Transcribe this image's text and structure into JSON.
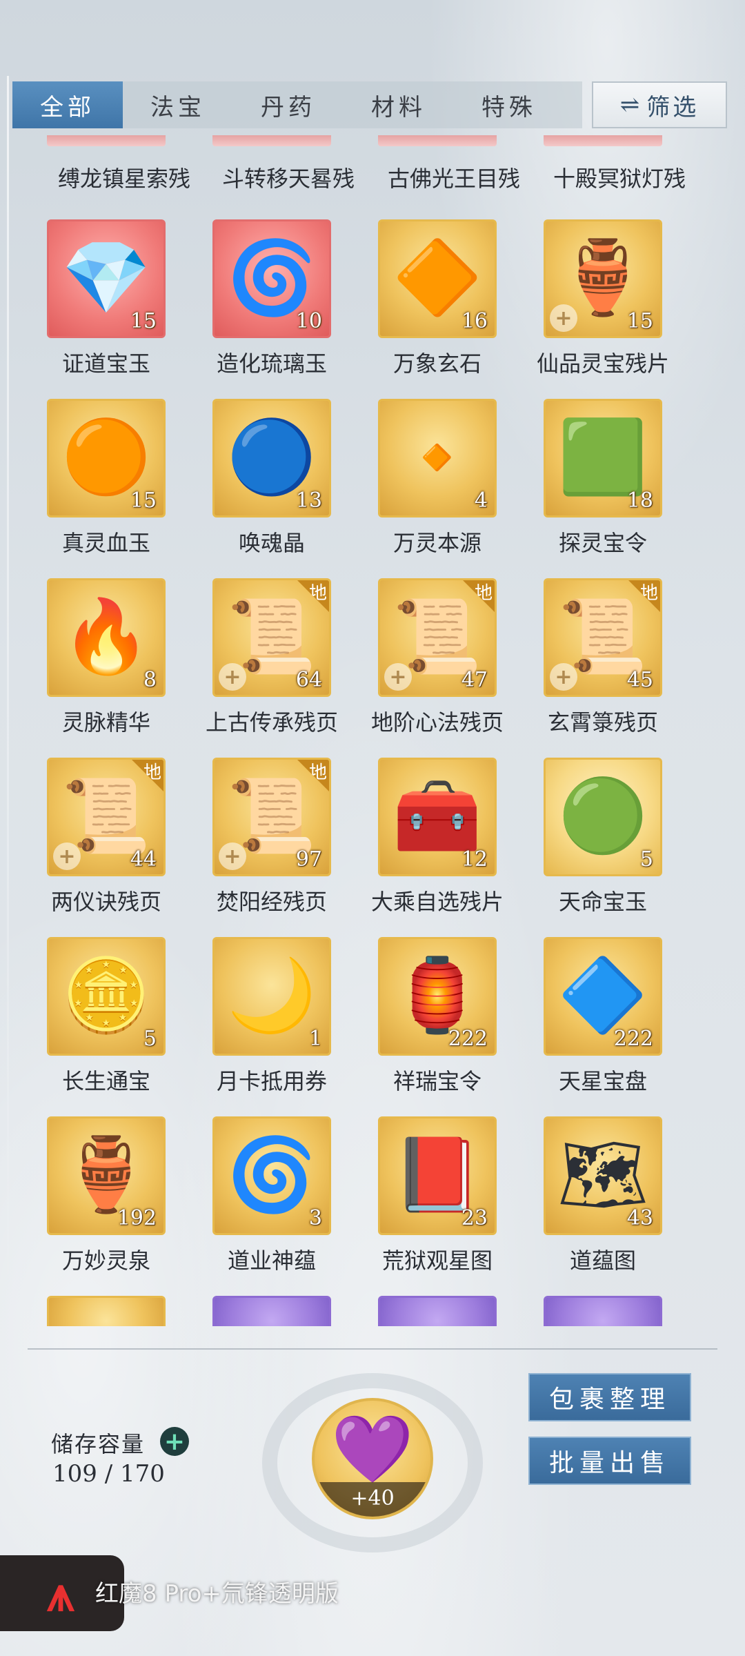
{
  "tabs": [
    {
      "label": "全部",
      "active": true
    },
    {
      "label": "法宝",
      "active": false
    },
    {
      "label": "丹药",
      "active": false
    },
    {
      "label": "材料",
      "active": false
    },
    {
      "label": "特殊",
      "active": false
    }
  ],
  "filter": {
    "label": "筛选",
    "icon": "swap-arrows-icon"
  },
  "partial_top_row": [
    {
      "name": "缚龙镇星索残"
    },
    {
      "name": "斗转移天晷残"
    },
    {
      "name": "古佛光王目残"
    },
    {
      "name": "十殿冥狱灯残"
    }
  ],
  "items": [
    {
      "name": "证道宝玉",
      "count": "15",
      "tier": "red",
      "icon": "crystal-icon",
      "glyph": "💎"
    },
    {
      "name": "造化琉璃玉",
      "count": "10",
      "tier": "red",
      "icon": "green-jade-icon",
      "glyph": "🌀"
    },
    {
      "name": "万象玄石",
      "count": "16",
      "tier": "gold",
      "icon": "mystic-stone-icon",
      "glyph": "🔶"
    },
    {
      "name": "仙品灵宝残片",
      "count": "15",
      "tier": "gold",
      "icon": "treasure-fragment-icon",
      "glyph": "🏺",
      "plus": true
    },
    {
      "name": "真灵血玉",
      "count": "15",
      "tier": "gold",
      "icon": "blood-jade-icon",
      "glyph": "🟠"
    },
    {
      "name": "唤魂晶",
      "count": "13",
      "tier": "gold",
      "icon": "soul-crystal-icon",
      "glyph": "🔵"
    },
    {
      "name": "万灵本源",
      "count": "4",
      "tier": "gold",
      "icon": "origin-stone-icon",
      "glyph": "🔸"
    },
    {
      "name": "探灵宝令",
      "count": "18",
      "tier": "gold",
      "icon": "green-token-icon",
      "glyph": "🟩"
    },
    {
      "name": "灵脉精华",
      "count": "8",
      "tier": "gold",
      "icon": "blue-flame-icon",
      "glyph": "🔥"
    },
    {
      "name": "上古传承残页",
      "count": "64",
      "tier": "gold",
      "icon": "scroll-page-icon",
      "glyph": "📜",
      "badge": "地",
      "plus": true
    },
    {
      "name": "地阶心法残页",
      "count": "47",
      "tier": "gold",
      "icon": "scroll-page-icon",
      "glyph": "📜",
      "badge": "地",
      "plus": true
    },
    {
      "name": "玄霄箓残页",
      "count": "45",
      "tier": "gold",
      "icon": "scroll-page-icon",
      "glyph": "📜",
      "badge": "地",
      "plus": true
    },
    {
      "name": "两仪诀残页",
      "count": "44",
      "tier": "gold",
      "icon": "scroll-page-icon",
      "glyph": "📜",
      "badge": "地",
      "plus": true
    },
    {
      "name": "焚阳经残页",
      "count": "97",
      "tier": "gold",
      "icon": "scroll-page-icon",
      "glyph": "📜",
      "badge": "地",
      "plus": true
    },
    {
      "name": "大乘自选残片",
      "count": "12",
      "tier": "gold",
      "icon": "treasure-chest-icon",
      "glyph": "🧰"
    },
    {
      "name": "天命宝玉",
      "count": "5",
      "tier": "gold-bright",
      "icon": "jade-orb-icon",
      "glyph": "🟢"
    },
    {
      "name": "长生通宝",
      "count": "5",
      "tier": "gold",
      "icon": "coin-icon",
      "glyph": "🪙"
    },
    {
      "name": "月卡抵用券",
      "count": "1",
      "tier": "gold",
      "icon": "moon-card-icon",
      "glyph": "🌙"
    },
    {
      "name": "祥瑞宝令",
      "count": "222",
      "tier": "gold",
      "icon": "auspicious-token-icon",
      "glyph": "🏮"
    },
    {
      "name": "天星宝盘",
      "count": "222",
      "tier": "gold",
      "icon": "star-disc-icon",
      "glyph": "🔷"
    },
    {
      "name": "万妙灵泉",
      "count": "192",
      "tier": "gold",
      "icon": "spirit-vase-icon",
      "glyph": "🏺"
    },
    {
      "name": "道业神蕴",
      "count": "3",
      "tier": "gold",
      "icon": "swirl-orb-icon",
      "glyph": "🌀"
    },
    {
      "name": "荒狱观星图",
      "count": "23",
      "tier": "gold",
      "icon": "star-map-scroll-icon",
      "glyph": "📕"
    },
    {
      "name": "道蕴图",
      "count": "43",
      "tier": "gold",
      "icon": "dao-chart-icon",
      "glyph": "🗺"
    }
  ],
  "partial_bottom_row": [
    {
      "tier": "gold",
      "icon": "item-icon"
    },
    {
      "tier": "purple",
      "icon": "item-icon"
    },
    {
      "tier": "purple",
      "icon": "potion-icon"
    },
    {
      "tier": "purple",
      "icon": "potion-icon"
    }
  ],
  "storage": {
    "label": "储存容量",
    "value": "109 / 170"
  },
  "featured": {
    "bonus": "+40",
    "icon": "purple-belt-icon",
    "glyph": "💜"
  },
  "buttons": {
    "organize": "包裹整理",
    "bulk_sell": "批量出售"
  },
  "watermark": {
    "text": "红魔8 Pro+氘锋透明版",
    "logo": "red-magic-logo-icon"
  },
  "colors": {
    "active_tab": "#4a82b4",
    "gold_tile": "#efc35d",
    "red_tile": "#f07a78",
    "purple_tile": "#9d7ddd",
    "button": "#3f70a0"
  }
}
